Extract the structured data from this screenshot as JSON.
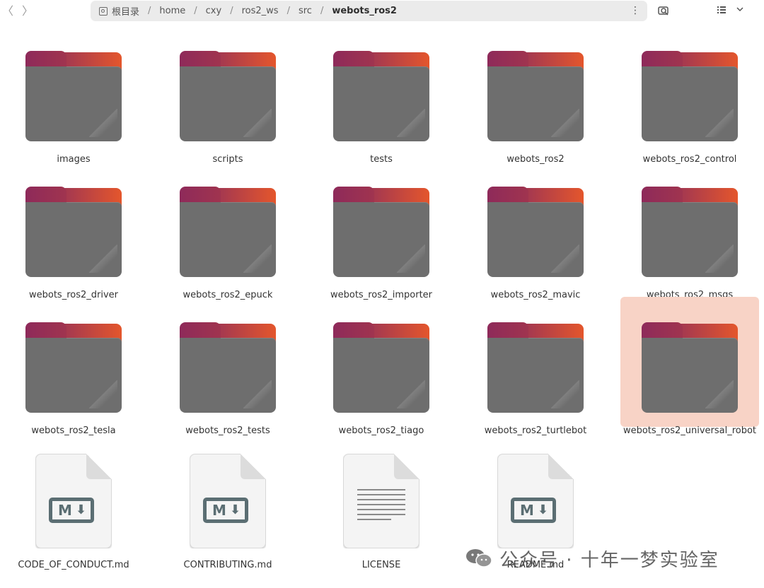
{
  "nav": {
    "back": "〈",
    "forward": "〉"
  },
  "pathbar": {
    "crumbs": [
      "根目录",
      "home",
      "cxy",
      "ros2_ws",
      "src",
      "webots_ros2"
    ],
    "separator": "/"
  },
  "items": [
    {
      "name": "images",
      "type": "folder"
    },
    {
      "name": "scripts",
      "type": "folder"
    },
    {
      "name": "tests",
      "type": "folder"
    },
    {
      "name": "webots_ros2",
      "type": "folder"
    },
    {
      "name": "webots_ros2_control",
      "type": "folder"
    },
    {
      "name": "webots_ros2_driver",
      "type": "folder"
    },
    {
      "name": "webots_ros2_epuck",
      "type": "folder"
    },
    {
      "name": "webots_ros2_importer",
      "type": "folder"
    },
    {
      "name": "webots_ros2_mavic",
      "type": "folder"
    },
    {
      "name": "webots_ros2_msgs",
      "type": "folder"
    },
    {
      "name": "webots_ros2_tesla",
      "type": "folder"
    },
    {
      "name": "webots_ros2_tests",
      "type": "folder"
    },
    {
      "name": "webots_ros2_tiago",
      "type": "folder"
    },
    {
      "name": "webots_ros2_turtlebot",
      "type": "folder"
    },
    {
      "name": "webots_ros2_universal_robot",
      "type": "folder",
      "selected": true
    }
  ],
  "files": [
    {
      "name": "CODE_OF_CONDUCT.md",
      "type": "markdown"
    },
    {
      "name": "CONTRIBUTING.md",
      "type": "markdown"
    },
    {
      "name": "LICENSE",
      "type": "text"
    },
    {
      "name": "README.md",
      "type": "markdown"
    }
  ],
  "watermark": {
    "text": "公众号 · 十年一梦实验室"
  },
  "colors": {
    "selection": "#f8d3c6",
    "folder": "#6e6e6e",
    "folder_accent": "#e4562c"
  }
}
